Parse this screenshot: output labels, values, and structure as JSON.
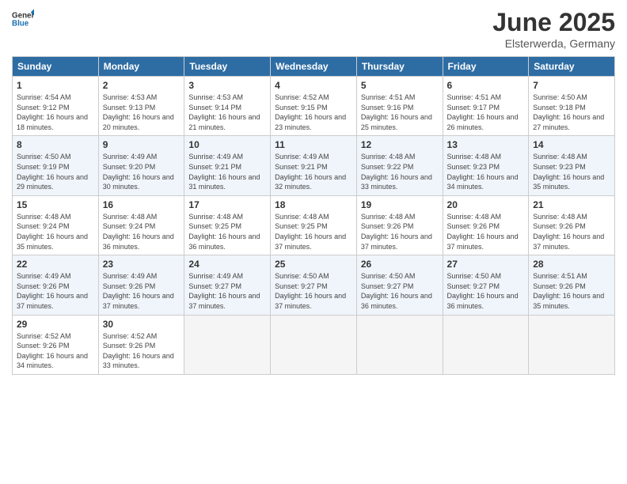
{
  "logo": {
    "general": "General",
    "blue": "Blue"
  },
  "title": "June 2025",
  "subtitle": "Elsterwerda, Germany",
  "weekdays": [
    "Sunday",
    "Monday",
    "Tuesday",
    "Wednesday",
    "Thursday",
    "Friday",
    "Saturday"
  ],
  "weeks": [
    [
      {
        "day": "1",
        "sunrise": "4:54 AM",
        "sunset": "9:12 PM",
        "daylight": "16 hours and 18 minutes."
      },
      {
        "day": "2",
        "sunrise": "4:53 AM",
        "sunset": "9:13 PM",
        "daylight": "16 hours and 20 minutes."
      },
      {
        "day": "3",
        "sunrise": "4:53 AM",
        "sunset": "9:14 PM",
        "daylight": "16 hours and 21 minutes."
      },
      {
        "day": "4",
        "sunrise": "4:52 AM",
        "sunset": "9:15 PM",
        "daylight": "16 hours and 23 minutes."
      },
      {
        "day": "5",
        "sunrise": "4:51 AM",
        "sunset": "9:16 PM",
        "daylight": "16 hours and 25 minutes."
      },
      {
        "day": "6",
        "sunrise": "4:51 AM",
        "sunset": "9:17 PM",
        "daylight": "16 hours and 26 minutes."
      },
      {
        "day": "7",
        "sunrise": "4:50 AM",
        "sunset": "9:18 PM",
        "daylight": "16 hours and 27 minutes."
      }
    ],
    [
      {
        "day": "8",
        "sunrise": "4:50 AM",
        "sunset": "9:19 PM",
        "daylight": "16 hours and 29 minutes."
      },
      {
        "day": "9",
        "sunrise": "4:49 AM",
        "sunset": "9:20 PM",
        "daylight": "16 hours and 30 minutes."
      },
      {
        "day": "10",
        "sunrise": "4:49 AM",
        "sunset": "9:21 PM",
        "daylight": "16 hours and 31 minutes."
      },
      {
        "day": "11",
        "sunrise": "4:49 AM",
        "sunset": "9:21 PM",
        "daylight": "16 hours and 32 minutes."
      },
      {
        "day": "12",
        "sunrise": "4:48 AM",
        "sunset": "9:22 PM",
        "daylight": "16 hours and 33 minutes."
      },
      {
        "day": "13",
        "sunrise": "4:48 AM",
        "sunset": "9:23 PM",
        "daylight": "16 hours and 34 minutes."
      },
      {
        "day": "14",
        "sunrise": "4:48 AM",
        "sunset": "9:23 PM",
        "daylight": "16 hours and 35 minutes."
      }
    ],
    [
      {
        "day": "15",
        "sunrise": "4:48 AM",
        "sunset": "9:24 PM",
        "daylight": "16 hours and 35 minutes."
      },
      {
        "day": "16",
        "sunrise": "4:48 AM",
        "sunset": "9:24 PM",
        "daylight": "16 hours and 36 minutes."
      },
      {
        "day": "17",
        "sunrise": "4:48 AM",
        "sunset": "9:25 PM",
        "daylight": "16 hours and 36 minutes."
      },
      {
        "day": "18",
        "sunrise": "4:48 AM",
        "sunset": "9:25 PM",
        "daylight": "16 hours and 37 minutes."
      },
      {
        "day": "19",
        "sunrise": "4:48 AM",
        "sunset": "9:26 PM",
        "daylight": "16 hours and 37 minutes."
      },
      {
        "day": "20",
        "sunrise": "4:48 AM",
        "sunset": "9:26 PM",
        "daylight": "16 hours and 37 minutes."
      },
      {
        "day": "21",
        "sunrise": "4:48 AM",
        "sunset": "9:26 PM",
        "daylight": "16 hours and 37 minutes."
      }
    ],
    [
      {
        "day": "22",
        "sunrise": "4:49 AM",
        "sunset": "9:26 PM",
        "daylight": "16 hours and 37 minutes."
      },
      {
        "day": "23",
        "sunrise": "4:49 AM",
        "sunset": "9:26 PM",
        "daylight": "16 hours and 37 minutes."
      },
      {
        "day": "24",
        "sunrise": "4:49 AM",
        "sunset": "9:27 PM",
        "daylight": "16 hours and 37 minutes."
      },
      {
        "day": "25",
        "sunrise": "4:50 AM",
        "sunset": "9:27 PM",
        "daylight": "16 hours and 37 minutes."
      },
      {
        "day": "26",
        "sunrise": "4:50 AM",
        "sunset": "9:27 PM",
        "daylight": "16 hours and 36 minutes."
      },
      {
        "day": "27",
        "sunrise": "4:50 AM",
        "sunset": "9:27 PM",
        "daylight": "16 hours and 36 minutes."
      },
      {
        "day": "28",
        "sunrise": "4:51 AM",
        "sunset": "9:26 PM",
        "daylight": "16 hours and 35 minutes."
      }
    ],
    [
      {
        "day": "29",
        "sunrise": "4:52 AM",
        "sunset": "9:26 PM",
        "daylight": "16 hours and 34 minutes."
      },
      {
        "day": "30",
        "sunrise": "4:52 AM",
        "sunset": "9:26 PM",
        "daylight": "16 hours and 33 minutes."
      },
      null,
      null,
      null,
      null,
      null
    ]
  ]
}
